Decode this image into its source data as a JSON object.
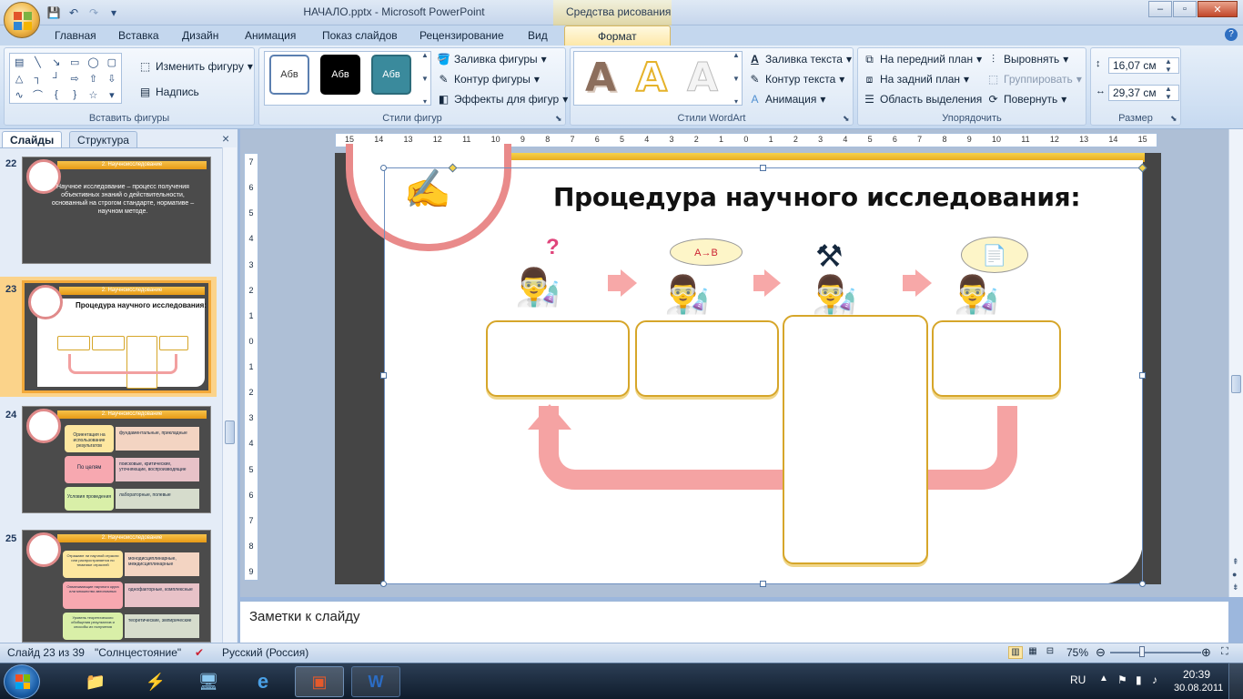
{
  "window": {
    "title": "НАЧАЛО.pptx - Microsoft PowerPoint",
    "context_tab_group": "Средства рисования",
    "minimize": "–",
    "maximize": "▫",
    "close": "✕"
  },
  "tabs": [
    {
      "label": "Главная"
    },
    {
      "label": "Вставка"
    },
    {
      "label": "Дизайн"
    },
    {
      "label": "Анимация"
    },
    {
      "label": "Показ слайдов"
    },
    {
      "label": "Рецензирование"
    },
    {
      "label": "Вид"
    },
    {
      "label": "Формат",
      "active": true
    }
  ],
  "ribbon": {
    "insert_shapes": {
      "label": "Вставить фигуры",
      "change_shape": "Изменить фигуру",
      "textbox": "Надпись"
    },
    "shape_styles": {
      "label": "Стили фигур",
      "swatch": "Абв",
      "fill": "Заливка фигуры",
      "outline": "Контур фигуры",
      "effects": "Эффекты для фигур"
    },
    "wordart": {
      "label": "Стили WordArt",
      "glyph": "A",
      "text_fill": "Заливка текста",
      "text_outline": "Контур текста",
      "animation": "Анимация"
    },
    "arrange": {
      "label": "Упорядочить",
      "bring_front": "На передний план",
      "send_back": "На задний план",
      "selection_pane": "Область выделения",
      "align": "Выровнять",
      "group": "Группировать",
      "rotate": "Повернуть"
    },
    "size": {
      "label": "Размер",
      "height": "16,07 см",
      "width": "29,37 см"
    }
  },
  "left_pane": {
    "tab_slides": "Слайды",
    "tab_outline": "Структура",
    "close": "×",
    "thumbnails": [
      {
        "num": "22",
        "header": "2. Научноисследование",
        "text": "Научное исследование – процесс получения объективных знаний о действительности, основанный на строгом стандарте, нормативе – научном методе."
      },
      {
        "num": "23",
        "header": "2. Научноисследование",
        "text": "Процедура научного исследования:",
        "selected": true
      },
      {
        "num": "24",
        "header": "2. Научноисследование",
        "rows": [
          "Ориентация на использование результатов",
          "По целям",
          "Условия проведения"
        ],
        "bullets": [
          "фундаментальные, прикладные",
          "поисковые, критические, уточняющие, воспроизводящие",
          "лабораторные, полевые"
        ]
      },
      {
        "num": "25",
        "header": "2. Научноисследование",
        "rows": [
          "Отражают ли научной отрасли или распространяется по тематике отраслей",
          "Охватывающие научного круга или множество автономных",
          "Уровень теоретического обобщения результатов и способы их получения"
        ],
        "bullets": [
          "монодисциплинарные, междисциплинарные",
          "однофакторные, комплексные",
          "теоретические, эмпирические"
        ]
      }
    ]
  },
  "ruler": {
    "h_ticks": [
      "15",
      "14",
      "13",
      "12",
      "11",
      "10",
      "9",
      "8",
      "7",
      "6",
      "5",
      "4",
      "3",
      "2",
      "1",
      "0",
      "1",
      "2",
      "3",
      "4",
      "5",
      "6",
      "7",
      "8",
      "9",
      "10",
      "11",
      "12",
      "13",
      "14",
      "15"
    ],
    "v_ticks": [
      "7",
      "6",
      "5",
      "4",
      "3",
      "2",
      "1",
      "0",
      "1",
      "2",
      "3",
      "4",
      "5",
      "6",
      "7",
      "8",
      "9"
    ]
  },
  "slide": {
    "title": "Процедура научного исследования:",
    "bubble_label": "A→B",
    "question_mark": "?"
  },
  "notes": {
    "placeholder": "Заметки к слайду"
  },
  "status": {
    "slide_info": "Слайд 23 из 39",
    "theme": "\"Солнцестояние\"",
    "language": "Русский (Россия)",
    "zoom": "75%"
  },
  "taskbar": {
    "lang": "RU",
    "time": "20:39",
    "date": "30.08.2011"
  },
  "colors": {
    "accent_gold": "#e4a51b",
    "slide_pink": "#f7a8a8",
    "box_border": "#d6a62a",
    "ribbon_active": "#fde7a6"
  }
}
